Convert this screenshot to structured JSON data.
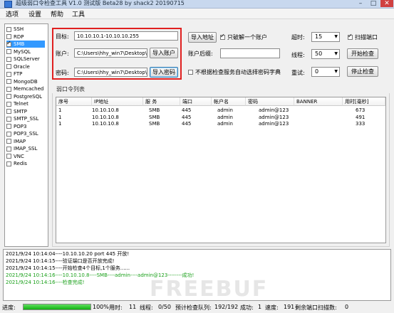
{
  "window": {
    "title": "超级弱口令检查工具 V1.0 测试版 Beta28 by shack2 20190715"
  },
  "menu": [
    "选项",
    "设置",
    "帮助",
    "工具"
  ],
  "protocols": [
    {
      "name": "SSH",
      "checked": false
    },
    {
      "name": "RDP",
      "checked": false
    },
    {
      "name": "SMB",
      "checked": true,
      "selected": true
    },
    {
      "name": "MySQL",
      "checked": false
    },
    {
      "name": "SQLServer",
      "checked": false
    },
    {
      "name": "Oracle",
      "checked": false
    },
    {
      "name": "FTP",
      "checked": false
    },
    {
      "name": "MongoDB",
      "checked": false
    },
    {
      "name": "Memcached",
      "checked": false
    },
    {
      "name": "PostgreSQL",
      "checked": false
    },
    {
      "name": "Telnet",
      "checked": false
    },
    {
      "name": "SMTP",
      "checked": false
    },
    {
      "name": "SMTP_SSL",
      "checked": false
    },
    {
      "name": "POP3",
      "checked": false
    },
    {
      "name": "POP3_SSL",
      "checked": false
    },
    {
      "name": "IMAP",
      "checked": false
    },
    {
      "name": "IMAP_SSL",
      "checked": false
    },
    {
      "name": "VNC",
      "checked": false
    },
    {
      "name": "Redis",
      "checked": false
    }
  ],
  "form": {
    "target_label": "目标:",
    "target_value": "10.10.10.1-10.10.10.255",
    "account_label": "账户:",
    "account_value": "C:\\Users\\hhy_win7\\Desktop\\",
    "import_account": "导入账户",
    "password_label": "密码:",
    "password_value": "C:\\Users\\hhy_win7\\Desktop\\",
    "import_password": "导入密码",
    "import_address": "导入地址",
    "only_one_label": "只破解一个账户",
    "only_one_checked": true,
    "account_suffix_label": "账户后缀:",
    "account_suffix_value": "",
    "no_auto_label": "不根据检查服务自动选择密码字典",
    "no_auto_checked": false,
    "timeout_label": "超时:",
    "timeout_value": "15",
    "threads_label": "线程:",
    "threads_value": "50",
    "retry_label": "重试:",
    "retry_value": "0",
    "scan_port_label": "扫描端口",
    "scan_port_checked": true,
    "start_button": "开始检查",
    "stop_button": "停止检查"
  },
  "results": {
    "group_title": "弱口令列表",
    "columns": [
      "序号",
      "IP地址",
      "服 务",
      "端口",
      "帐户名",
      "密码",
      "BANNER",
      "用时[毫秒]"
    ],
    "rows": [
      [
        "1",
        "10.10.10.8",
        "SMB",
        "445",
        "admin",
        "admin@123",
        "",
        "673"
      ],
      [
        "1",
        "10.10.10.8",
        "SMB",
        "445",
        "admin",
        "admin@123",
        "",
        "491"
      ],
      [
        "1",
        "10.10.10.8",
        "SMB",
        "445",
        "admin",
        "admin@123",
        "",
        "333"
      ]
    ]
  },
  "log": [
    {
      "text": "2021/9/24 10:14:04----10.10.10.20 port 445 开放!",
      "color": "#000000"
    },
    {
      "text": "2021/9/24 10:14:15----验证端口是否开放完成!",
      "color": "#000000"
    },
    {
      "text": "2021/9/24 10:14:15----开始检查4个目标,1个服务......",
      "color": "#000000"
    },
    {
      "text": "2021/9/24 10:14:16----10.10.10.8----SMB----admin----admin@123--------成功!",
      "color": "#1aa01a"
    },
    {
      "text": "2021/9/24 10:14:16----检查完成!",
      "color": "#1aa01a"
    }
  ],
  "watermark": "FREEBUF",
  "status": {
    "progress_label": "进度:",
    "progress_fraction": 1.0,
    "progress_text": "100%",
    "elapsed_label": "用时:",
    "elapsed_value": "11",
    "threads_label": "线程:",
    "threads_value": "0/50",
    "queue_label": "预计检查队列:",
    "queue_value": "192/192",
    "success_label": "成功:",
    "success_value": "1",
    "speed_label": "速度:",
    "speed_value": "191",
    "remaining_label": "剩余端口扫描数:",
    "remaining_value": "0"
  },
  "colors": {
    "highlight": "#3399ff",
    "red_box": "#e02020",
    "log_success": "#1aa01a",
    "progress": "#12b012"
  }
}
